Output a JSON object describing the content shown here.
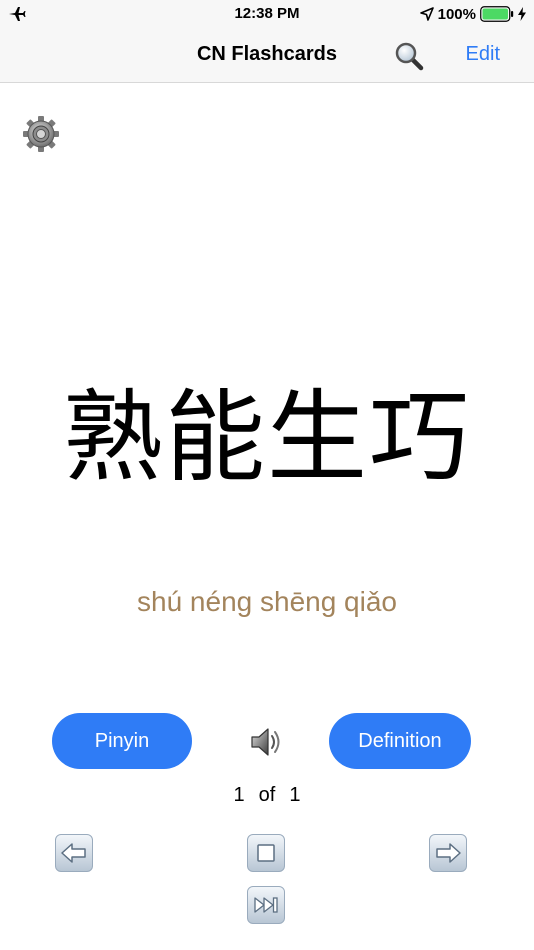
{
  "status_bar": {
    "time": "12:38 PM",
    "battery_percent": "100%",
    "icons": [
      "airplane-icon",
      "location-arrow-icon",
      "battery-icon",
      "charging-bolt-icon"
    ]
  },
  "nav": {
    "title": "CN Flashcards",
    "edit_label": "Edit",
    "icons": [
      "search-icon"
    ]
  },
  "card": {
    "hanzi": "熟能生巧",
    "pinyin": "shú néng shēng qiǎo"
  },
  "buttons": {
    "pinyin_label": "Pinyin",
    "definition_label": "Definition"
  },
  "counter": {
    "current": "1",
    "of_label": "of",
    "total": "1"
  },
  "controls": {
    "icons": [
      "settings-gear-icon",
      "speaker-icon",
      "prev-arrow-icon",
      "stop-icon",
      "next-arrow-icon",
      "skip-forward-icon"
    ]
  },
  "colors": {
    "accent": "#2f7cf6",
    "pinyin": "#a3845c",
    "battery": "#4cd964"
  }
}
